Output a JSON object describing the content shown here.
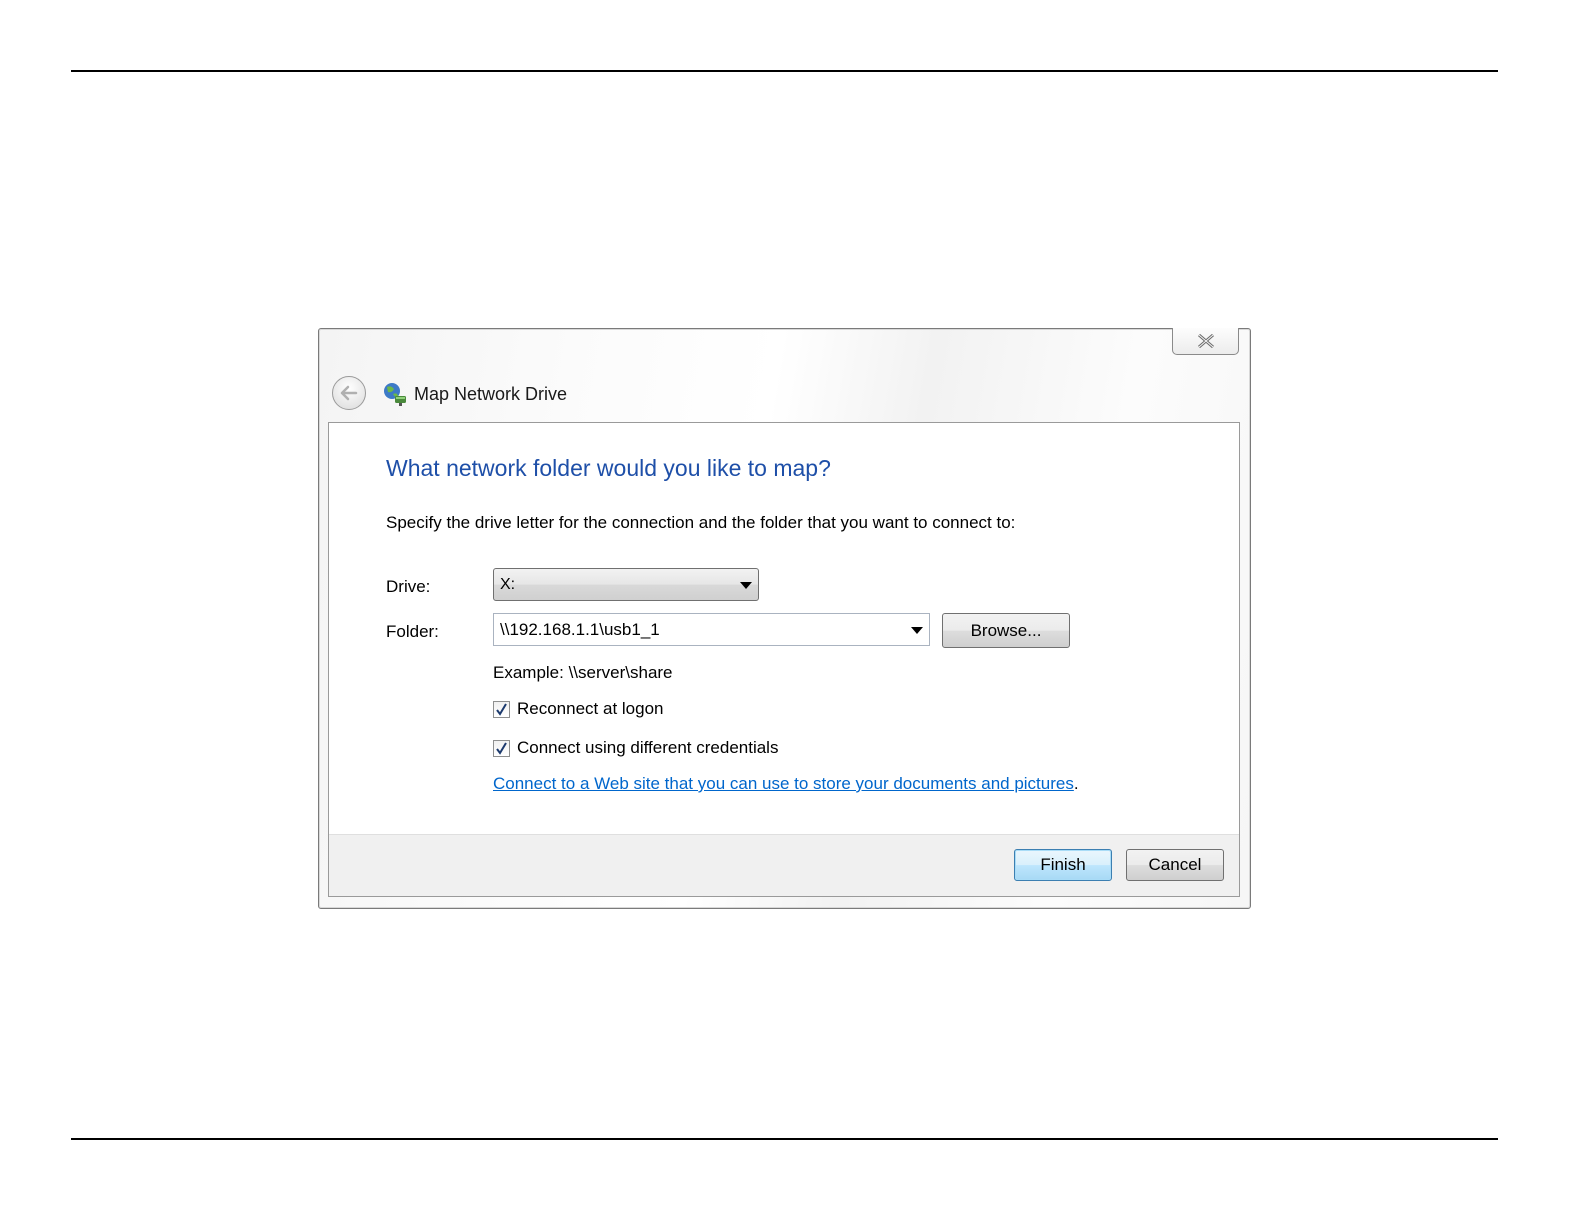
{
  "dialog": {
    "title": "Map Network Drive",
    "heading": "What network folder would you like to map?",
    "instruction": "Specify the drive letter for the connection and the folder that you want to connect to:"
  },
  "form": {
    "drive_label": "Drive:",
    "drive_value": "X:",
    "folder_label": "Folder:",
    "folder_value": "\\\\192.168.1.1\\usb1_1",
    "browse_label": "Browse...",
    "example_text": "Example: \\\\server\\share",
    "reconnect_label": "Reconnect at logon",
    "reconnect_checked": true,
    "credentials_label": "Connect using different credentials",
    "credentials_checked": true,
    "link_text": "Connect to a Web site that you can use to store your documents and pictures",
    "link_suffix": "."
  },
  "buttons": {
    "finish": "Finish",
    "cancel": "Cancel"
  },
  "colors": {
    "heading": "#1e4fa8",
    "link": "#0066cc"
  }
}
